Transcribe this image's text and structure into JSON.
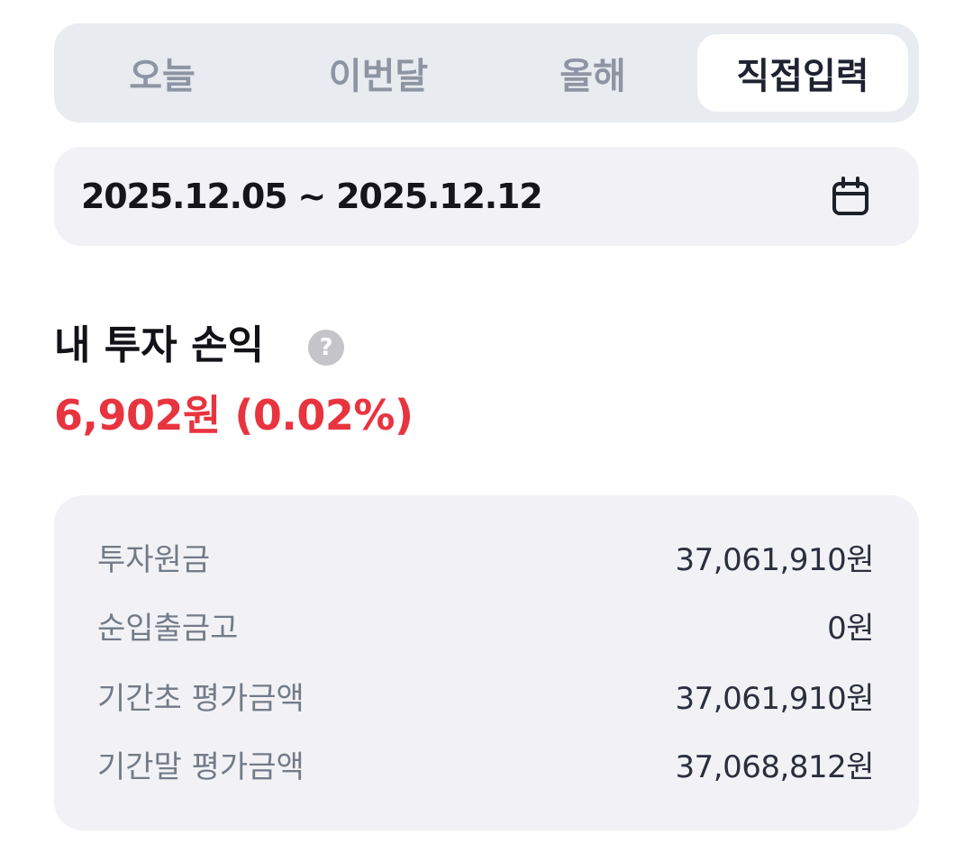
{
  "period_tabs": [
    {
      "label": "오늘",
      "active": false
    },
    {
      "label": "이번달",
      "active": false
    },
    {
      "label": "올해",
      "active": false
    },
    {
      "label": "직접입력",
      "active": true
    }
  ],
  "date_range": {
    "text": "2025.12.05 ~ 2025.12.12",
    "icon": "calendar-icon"
  },
  "summary": {
    "title": "내 투자 손익",
    "help_icon": "question-icon",
    "help_glyph": "?",
    "profit_text": "6,902원 (0.02%)",
    "profit_color": "#e8343f"
  },
  "details": [
    {
      "label": "투자원금",
      "value": "37,061,910원"
    },
    {
      "label": "순입출금고",
      "value": "0원"
    },
    {
      "label": "기간초 평가금액",
      "value": "37,061,910원"
    },
    {
      "label": "기간말 평가금액",
      "value": "37,068,812원"
    }
  ],
  "colors": {
    "segment_bg": "#e8ebf0",
    "card_bg": "#f2f2f6",
    "profit_red": "#e8343f"
  }
}
